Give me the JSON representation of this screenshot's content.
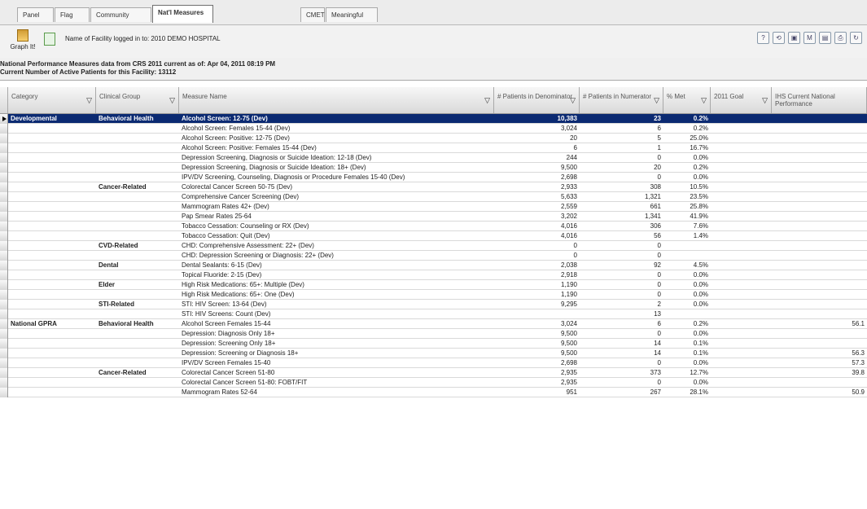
{
  "tabs": [
    "Panel List",
    "Flag List",
    "Community Alerts",
    "Nat'l Measures",
    "CMET",
    "Meaningful Use"
  ],
  "active_tab": 3,
  "toolbar": {
    "graph_label": "Graph It!",
    "facility_text": "Name of Facility logged in to: 2010 DEMO HOSPITAL",
    "right_icons": [
      "?",
      "⟲",
      "▣",
      "M",
      "▤",
      "⎙",
      "↻"
    ]
  },
  "headline": {
    "line1": "National Performance Measures data from CRS 2011 current as of: Apr 04, 2011 08:19 PM",
    "line2": "Current Number of Active Patients for this Facility: 13112"
  },
  "columns": [
    "Category",
    "Clinical Group",
    "Measure Name",
    "# Patients in Denominator",
    "# Patients in Numerator",
    "% Met",
    "2011 Goal",
    "IHS Current National Performance"
  ],
  "rows": [
    {
      "category": "Developmental",
      "group": "Behavioral Health",
      "measure": "Alcohol Screen: 12-75 (Dev)",
      "den": "10,383",
      "num": "23",
      "pct": "0.2%",
      "goal": "",
      "ihs": "",
      "selected": true
    },
    {
      "category": "",
      "group": "",
      "measure": "Alcohol Screen: Females 15-44 (Dev)",
      "den": "3,024",
      "num": "6",
      "pct": "0.2%",
      "goal": "",
      "ihs": ""
    },
    {
      "category": "",
      "group": "",
      "measure": "Alcohol Screen: Positive: 12-75 (Dev)",
      "den": "20",
      "num": "5",
      "pct": "25.0%",
      "goal": "",
      "ihs": ""
    },
    {
      "category": "",
      "group": "",
      "measure": "Alcohol Screen: Positive: Females 15-44 (Dev)",
      "den": "6",
      "num": "1",
      "pct": "16.7%",
      "goal": "",
      "ihs": ""
    },
    {
      "category": "",
      "group": "",
      "measure": "Depression Screening, Diagnosis or Suicide Ideation: 12-18 (Dev)",
      "den": "244",
      "num": "0",
      "pct": "0.0%",
      "goal": "",
      "ihs": ""
    },
    {
      "category": "",
      "group": "",
      "measure": "Depression Screening, Diagnosis or Suicide Ideation: 18+ (Dev)",
      "den": "9,500",
      "num": "20",
      "pct": "0.2%",
      "goal": "",
      "ihs": ""
    },
    {
      "category": "",
      "group": "",
      "measure": "IPV/DV Screening, Counseling, Diagnosis or Procedure Females 15-40 (Dev)",
      "den": "2,698",
      "num": "0",
      "pct": "0.0%",
      "goal": "",
      "ihs": ""
    },
    {
      "category": "",
      "group": "Cancer-Related",
      "measure": "Colorectal Cancer Screen 50-75 (Dev)",
      "den": "2,933",
      "num": "308",
      "pct": "10.5%",
      "goal": "",
      "ihs": ""
    },
    {
      "category": "",
      "group": "",
      "measure": "Comprehensive Cancer Screening (Dev)",
      "den": "5,633",
      "num": "1,321",
      "pct": "23.5%",
      "goal": "",
      "ihs": ""
    },
    {
      "category": "",
      "group": "",
      "measure": "Mammogram Rates 42+ (Dev)",
      "den": "2,559",
      "num": "661",
      "pct": "25.8%",
      "goal": "",
      "ihs": ""
    },
    {
      "category": "",
      "group": "",
      "measure": "Pap Smear Rates 25-64",
      "den": "3,202",
      "num": "1,341",
      "pct": "41.9%",
      "goal": "",
      "ihs": ""
    },
    {
      "category": "",
      "group": "",
      "measure": "Tobacco Cessation: Counseling or RX (Dev)",
      "den": "4,016",
      "num": "306",
      "pct": "7.6%",
      "goal": "",
      "ihs": ""
    },
    {
      "category": "",
      "group": "",
      "measure": "Tobacco Cessation: Quit (Dev)",
      "den": "4,016",
      "num": "56",
      "pct": "1.4%",
      "goal": "",
      "ihs": ""
    },
    {
      "category": "",
      "group": "CVD-Related",
      "measure": "CHD: Comprehensive Assessment: 22+ (Dev)",
      "den": "0",
      "num": "0",
      "pct": "",
      "goal": "",
      "ihs": ""
    },
    {
      "category": "",
      "group": "",
      "measure": "CHD: Depression Screening or Diagnosis: 22+ (Dev)",
      "den": "0",
      "num": "0",
      "pct": "",
      "goal": "",
      "ihs": ""
    },
    {
      "category": "",
      "group": "Dental",
      "measure": "Dental Sealants: 6-15 (Dev)",
      "den": "2,038",
      "num": "92",
      "pct": "4.5%",
      "goal": "",
      "ihs": ""
    },
    {
      "category": "",
      "group": "",
      "measure": "Topical Fluoride: 2-15 (Dev)",
      "den": "2,918",
      "num": "0",
      "pct": "0.0%",
      "goal": "",
      "ihs": ""
    },
    {
      "category": "",
      "group": "Elder",
      "measure": "High Risk Medications: 65+: Multiple (Dev)",
      "den": "1,190",
      "num": "0",
      "pct": "0.0%",
      "goal": "",
      "ihs": ""
    },
    {
      "category": "",
      "group": "",
      "measure": "High Risk Medications: 65+: One (Dev)",
      "den": "1,190",
      "num": "0",
      "pct": "0.0%",
      "goal": "",
      "ihs": ""
    },
    {
      "category": "",
      "group": "STI-Related",
      "measure": "STI: HIV Screen: 13-64 (Dev)",
      "den": "9,295",
      "num": "2",
      "pct": "0.0%",
      "goal": "",
      "ihs": ""
    },
    {
      "category": "",
      "group": "",
      "measure": "STI: HIV Screens: Count (Dev)",
      "den": "",
      "num": "13",
      "pct": "",
      "goal": "",
      "ihs": ""
    },
    {
      "category": "National GPRA",
      "group": "Behavioral Health",
      "measure": "Alcohol Screen Females 15-44",
      "den": "3,024",
      "num": "6",
      "pct": "0.2%",
      "goal": "",
      "ihs": "56.1"
    },
    {
      "category": "",
      "group": "",
      "measure": "Depression: Diagnosis Only 18+",
      "den": "9,500",
      "num": "0",
      "pct": "0.0%",
      "goal": "",
      "ihs": ""
    },
    {
      "category": "",
      "group": "",
      "measure": "Depression: Screening Only 18+",
      "den": "9,500",
      "num": "14",
      "pct": "0.1%",
      "goal": "",
      "ihs": ""
    },
    {
      "category": "",
      "group": "",
      "measure": "Depression: Screening or Diagnosis 18+",
      "den": "9,500",
      "num": "14",
      "pct": "0.1%",
      "goal": "",
      "ihs": "56.3"
    },
    {
      "category": "",
      "group": "",
      "measure": "IPV/DV Screen Females 15-40",
      "den": "2,698",
      "num": "0",
      "pct": "0.0%",
      "goal": "",
      "ihs": "57.3"
    },
    {
      "category": "",
      "group": "Cancer-Related",
      "measure": "Colorectal Cancer Screen 51-80",
      "den": "2,935",
      "num": "373",
      "pct": "12.7%",
      "goal": "",
      "ihs": "39.8"
    },
    {
      "category": "",
      "group": "",
      "measure": "Colorectal Cancer Screen 51-80: FOBT/FIT",
      "den": "2,935",
      "num": "0",
      "pct": "0.0%",
      "goal": "",
      "ihs": ""
    },
    {
      "category": "",
      "group": "",
      "measure": "Mammogram Rates 52-64",
      "den": "951",
      "num": "267",
      "pct": "28.1%",
      "goal": "",
      "ihs": "50.9"
    }
  ]
}
